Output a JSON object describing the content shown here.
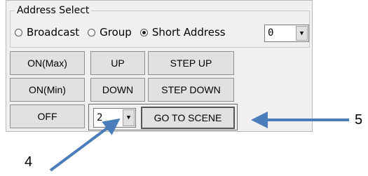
{
  "address_select": {
    "legend": "Address Select",
    "options": [
      "Broadcast",
      "Group",
      "Short Address"
    ],
    "selected_index": 2,
    "address_value": "0"
  },
  "buttons": {
    "on_max": "ON(Max)",
    "on_min": "ON(Min)",
    "off": "OFF",
    "up": "UP",
    "down": "DOWN",
    "step_up": "STEP UP",
    "step_down": "STEP DOWN"
  },
  "scene": {
    "value": "2",
    "go_label": "GO TO SCENE"
  },
  "callouts": {
    "label_4": "4",
    "label_5": "5"
  },
  "colors": {
    "arrow": "#4a7ebb"
  }
}
